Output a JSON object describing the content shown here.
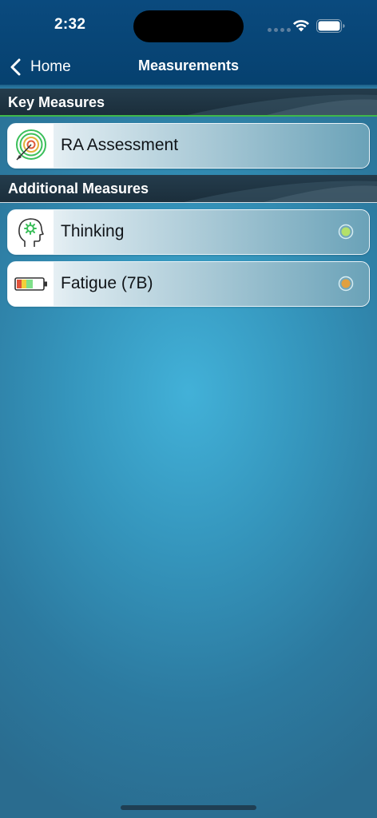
{
  "status_bar": {
    "time": "2:32",
    "icons": [
      "cellular-signal-icon",
      "wifi-icon",
      "battery-icon"
    ]
  },
  "nav": {
    "back_label": "Home",
    "title": "Measurements"
  },
  "sections": [
    {
      "title": "Key Measures",
      "items": [
        {
          "label": "RA Assessment",
          "icon": "target-icon",
          "indicator": null
        }
      ]
    },
    {
      "title": "Additional Measures",
      "items": [
        {
          "label": "Thinking",
          "icon": "head-gear-icon",
          "indicator": "green"
        },
        {
          "label": "Fatigue (7B)",
          "icon": "battery-level-icon",
          "indicator": "orange"
        }
      ]
    }
  ],
  "colors": {
    "header_bg": "#06416f",
    "section_bg": "#1b2e3b",
    "indicator_green": "#b4e06a",
    "indicator_orange": "#e0a040",
    "background": "#3596bd"
  }
}
